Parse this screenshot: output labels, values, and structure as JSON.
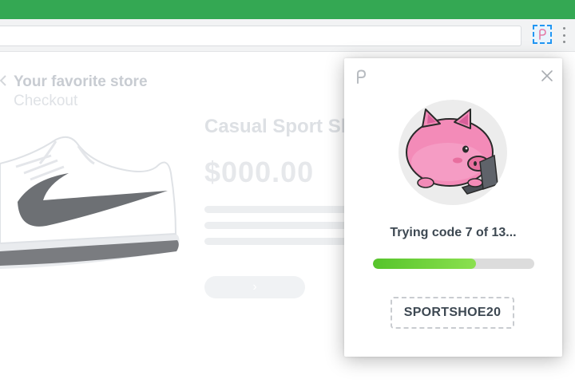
{
  "browser": {
    "tab_strip_color": "#34a853",
    "extension_icon": "honey-p-icon",
    "menu_icon": "kebab-menu-icon"
  },
  "store": {
    "name": "Your favorite store",
    "subtitle": "Checkout",
    "product_title": "Casual Sport Sh",
    "price": "$000.00",
    "buy_button_icon": "chevron-right-icon",
    "buy_button_glyph": "›"
  },
  "popup": {
    "logo_icon": "honey-logo-icon",
    "close_icon": "close-icon",
    "mascot": "pig-typing-laptop",
    "status_text": "Trying code 7 of 13...",
    "progress": {
      "current": 7,
      "total": 13,
      "fraction": 0.64
    },
    "progress_color": "#6fd23d",
    "coupon_code": "SPORTSHOE20"
  }
}
